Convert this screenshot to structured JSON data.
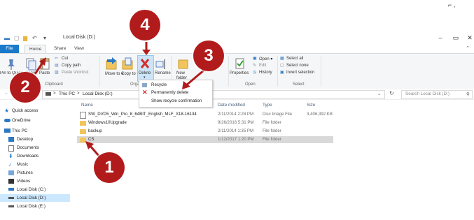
{
  "window": {
    "title": "Local Disk (D:)",
    "controls": [
      "–",
      "▭",
      "✕"
    ]
  },
  "tabs": {
    "file": "File",
    "home": "Home",
    "share": "Share",
    "view": "View"
  },
  "ribbon": {
    "clipboard": {
      "pin": "Pin to Quick access",
      "copy": "Copy",
      "paste": "Paste",
      "cut": "Cut",
      "copy_path": "Copy path",
      "paste_shortcut": "Paste shortcut",
      "group": "Clipboard"
    },
    "organize": {
      "move_to": "Move to ▾",
      "copy_to": "Copy to ▾",
      "delete": "Delete",
      "rename": "Rename",
      "group": "Orga"
    },
    "new": {
      "new_folder": "New folder"
    },
    "open": {
      "properties": "Properties",
      "open": "Open ▾",
      "edit": "Edit",
      "history": "History",
      "group": "Open"
    },
    "select": {
      "select_all": "Select all",
      "select_none": "Select none",
      "invert": "Invert selection",
      "group": "Select"
    }
  },
  "delete_menu": {
    "items": [
      "Recycle",
      "Permanently delete",
      "Show recycle confirmation"
    ]
  },
  "address": {
    "crumbs": [
      "This PC",
      "Local Disk (D:)"
    ],
    "separator": ">",
    "search_placeholder": "Search Local Disk (D:)"
  },
  "nav": {
    "items": [
      "Quick access",
      "OneDrive",
      "This PC",
      "Desktop",
      "Documents",
      "Downloads",
      "Music",
      "Pictures",
      "Videos",
      "Local Disk (C:)",
      "Local Disk (D:)",
      "Local Disk (E:)"
    ]
  },
  "columns": {
    "name": "Name",
    "date": "Date modified",
    "type": "Type",
    "size": "Size"
  },
  "files": [
    {
      "name": "SW_DVD5_Win_Pro_8_64BIT_English_MLF_X18-16134",
      "date": "2/11/2014 2:28 PM",
      "type": "Disc Image File",
      "size": "3,406,392 KB"
    },
    {
      "name": "Windows10Upgrade",
      "date": "9/26/2016 5:31 PM",
      "type": "File folder",
      "size": ""
    },
    {
      "name": "backup",
      "date": "2/11/2014 1:35 PM",
      "type": "File folder",
      "size": ""
    },
    {
      "name": "CS",
      "date": "1/12/2017 1:20 PM",
      "type": "File folder",
      "size": ""
    }
  ],
  "callouts": {
    "one": "1",
    "two": "2",
    "three": "3",
    "four": "4"
  },
  "colors": {
    "file_tab": "#1979ca",
    "callout": "#b21b1b",
    "delete_red": "#d32f2f",
    "selected_row": "#cce8ff",
    "folder": "#f2c55c"
  }
}
